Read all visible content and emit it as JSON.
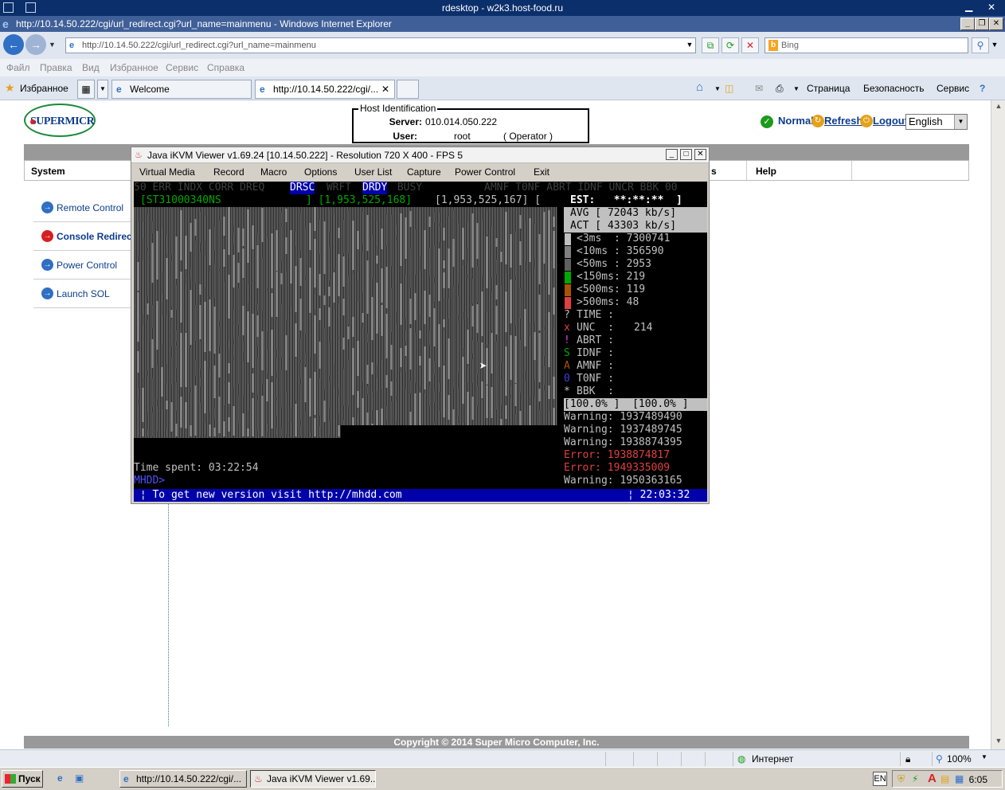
{
  "rdesktop": {
    "title": "rdesktop - w2k3.host-food.ru"
  },
  "ie": {
    "title": "http://10.14.50.222/cgi/url_redirect.cgi?url_name=mainmenu - Windows Internet Explorer",
    "url": "http://10.14.50.222/cgi/url_redirect.cgi?url_name=mainmenu",
    "search_placeholder": "Bing",
    "menu": [
      "Файл",
      "Правка",
      "Вид",
      "Избранное",
      "Сервис",
      "Справка"
    ],
    "favorites_label": "Избранное",
    "tabs": [
      {
        "label": "Welcome"
      },
      {
        "label": "http://10.14.50.222/cgi/..."
      }
    ],
    "commands": [
      "Страница",
      "Безопасность",
      "Сервис"
    ],
    "status": {
      "zone": "Интернет",
      "zoom": "100%"
    }
  },
  "page": {
    "logo": "SUPERMICR",
    "host_identification": {
      "legend": "Host Identification",
      "server_label": "Server:",
      "server_value": "010.014.050.222",
      "user_label": "User:",
      "user_value": "root",
      "user_role": "( Operator )"
    },
    "status_text": "Normal",
    "refresh": "Refresh",
    "logout": "Logout",
    "language": "English",
    "nav": {
      "system": "System",
      "partial": "s",
      "help": "Help"
    },
    "sidebar": [
      {
        "label": "Remote Control",
        "color": "#2f6fc4"
      },
      {
        "label": "Console Redirec",
        "color": "#d62020"
      },
      {
        "label": "Power Control",
        "color": "#2f6fc4"
      },
      {
        "label": "Launch SOL",
        "color": "#2f6fc4"
      }
    ],
    "copyright": "Copyright © 2014 Super Micro Computer, Inc."
  },
  "kvm": {
    "title": "Java iKVM Viewer v1.69.24 [10.14.50.222]  - Resolution 720 X 400 - FPS 5",
    "menu": [
      "Virtual Media",
      "Record",
      "Macro",
      "Options",
      "User List",
      "Capture",
      "Power Control",
      "Exit"
    ],
    "terminal": {
      "flags_a": "50 ERR INDX CORR DREQ ",
      "flag_drsc": "DRSC",
      "flag_wrft": " WRFT ",
      "flag_drdy": "DRDY",
      "flag_busy": " BUSY",
      "flags_right": "AMNF T0NF ABRT IDNF UNCR BBK 00",
      "drive_model": "[ST31000340NS",
      "lba_current": "] [1,953,525,168]",
      "lba_total": "[1,953,525,167] [",
      "est": "EST:   **:**:**  ]",
      "avg": "AVG [ 72043 kb/s]",
      "act": "ACT [ 43303 kb/s]",
      "timing": [
        {
          "label": "<3ms  : 7300741",
          "color": "#c0c0c0"
        },
        {
          "label": "<10ms : 356590",
          "color": "#808080"
        },
        {
          "label": "<50ms : 2953",
          "color": "#606060"
        },
        {
          "label": "<150ms: 219",
          "color": "#00a800"
        },
        {
          "label": "<500ms: 119",
          "color": "#a85400"
        },
        {
          "label": ">500ms: 48",
          "color": "#e04040"
        }
      ],
      "errors": [
        {
          "sym": "?",
          "label": "TIME :",
          "value": "",
          "color": "#c0c0c0"
        },
        {
          "sym": "x",
          "label": "UNC  :",
          "value": "214",
          "color": "#e04040"
        },
        {
          "sym": "!",
          "label": "ABRT :",
          "value": "",
          "color": "#e040e0"
        },
        {
          "sym": "S",
          "label": "IDNF :",
          "value": "",
          "color": "#00a800"
        },
        {
          "sym": "A",
          "label": "AMNF :",
          "value": "",
          "color": "#a85400"
        },
        {
          "sym": "0",
          "label": "T0NF :",
          "value": "",
          "color": "#4040e0"
        },
        {
          "sym": "*",
          "label": "BBK  :",
          "value": "",
          "color": "#c0c0c0"
        }
      ],
      "percent": "[100.0% ]  [100.0% ]",
      "log": [
        {
          "text": "Warning: 1937489490",
          "color": "#c0c0c0"
        },
        {
          "text": "Warning: 1937489745",
          "color": "#c0c0c0"
        },
        {
          "text": "Warning: 1938874395",
          "color": "#c0c0c0"
        },
        {
          "text": "Error: ",
          "value": "1938874817",
          "color": "#e04040"
        },
        {
          "text": "Error: ",
          "value": "1949335009",
          "color": "#e04040"
        },
        {
          "text": "Warning: 1950363165",
          "color": "#c0c0c0"
        }
      ],
      "time_spent": "Time spent: 03:22:54",
      "prompt": "MHDD>",
      "bottom_left": " ¦ To get new version visit http://mhdd.com",
      "bottom_right": "¦ 22:03:32 "
    }
  },
  "taskbar": {
    "start": "Пуск",
    "buttons": [
      "http://10.14.50.222/cgi/...",
      "Java iKVM Viewer v1.69...."
    ],
    "lang": "EN",
    "clock": "6:05"
  }
}
